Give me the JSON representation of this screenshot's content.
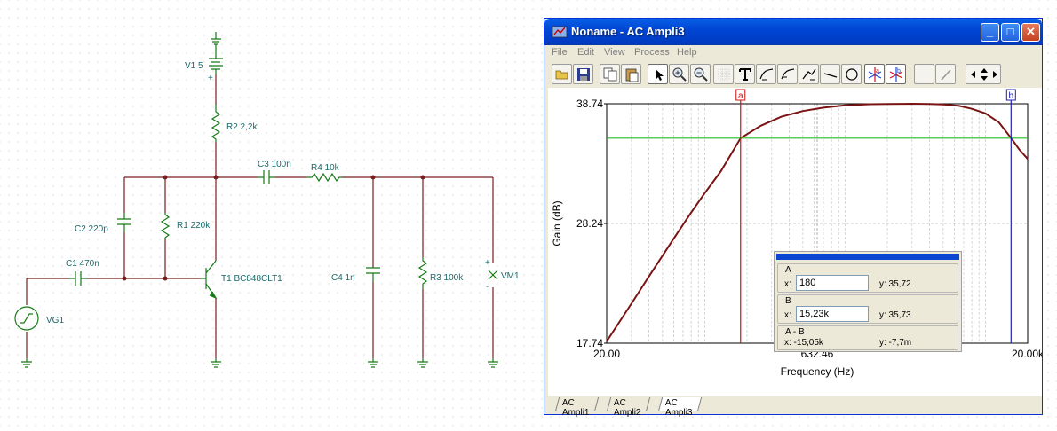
{
  "schematic": {
    "v1_label": "V1 5",
    "plus_sign": "+",
    "r2_label": "R2 2,2k",
    "c3_label": "C3 100n",
    "r4_label": "R4 10k",
    "c2_label": "C2 220p",
    "r1_label": "R1 220k",
    "c1_label": "C1 470n",
    "t1_label": "T1 BC848CLT1",
    "c4_label": "C4 1n",
    "r3_label": "R3 100k",
    "vm1_label": "VM1",
    "vm_plus": "+",
    "vm_minus": "-",
    "vg1_label": "VG1",
    "colors": {
      "wire": "#7a1f1f",
      "component": "#167a16",
      "label": "#1a6a6a"
    }
  },
  "window": {
    "title": "Noname - AC Ampli3",
    "menu": [
      "File",
      "Edit",
      "View",
      "Process",
      "Help"
    ],
    "minimize_glyph": "_",
    "maximize_glyph": "□",
    "close_glyph": "✕",
    "toolbar_icons": [
      "open-folder-icon",
      "save-icon",
      "copy-icon",
      "paste-icon",
      "pointer-icon",
      "zoom-in-icon",
      "zoom-100-icon",
      "grid-icon",
      "text-icon",
      "curve-tool-icon",
      "curve-tool-2-icon",
      "curve-tool-3-icon",
      "line-icon",
      "circle-icon",
      "cursor-a-icon",
      "cursor-b-icon",
      "blank-tool-icon",
      "pen-icon",
      "arrows-icon"
    ],
    "tabs": [
      "AC Ampli1",
      "AC Ampli2",
      "AC Ampli3"
    ],
    "active_tab": 2
  },
  "cursors": {
    "a_label": "a",
    "b_label": "b",
    "a_freq": 180,
    "b_freq": 15230,
    "level_db": 35.72
  },
  "cursor_panel": {
    "a": {
      "name": "A",
      "x_label": "x:",
      "x_value": "180",
      "y_text": "y: 35,72"
    },
    "b": {
      "name": "B",
      "x_label": "x:",
      "x_value": "15,23k",
      "y_text": "y: 35,73"
    },
    "ab": {
      "name": "A - B",
      "x_text": "x: -15,05k",
      "y_text": "y: -7,7m"
    }
  },
  "chart_data": {
    "type": "line",
    "xlabel": "Frequency (Hz)",
    "ylabel": "Gain (dB)",
    "x_scale": "log",
    "xlim": [
      20,
      20000
    ],
    "ylim": [
      17.74,
      38.74
    ],
    "x_ticks": [
      {
        "value": 20,
        "label": "20.00"
      },
      {
        "value": 632.46,
        "label": "632.46"
      },
      {
        "value": 20000,
        "label": "20.00k"
      }
    ],
    "y_ticks": [
      {
        "value": 38.74,
        "label": "38.74"
      },
      {
        "value": 28.24,
        "label": "28.24"
      },
      {
        "value": 17.74,
        "label": "17.74"
      }
    ],
    "grid": true,
    "series": [
      {
        "color": "#7a1414",
        "x": [
          20,
          30,
          40,
          60,
          80,
          100,
          130,
          180,
          250,
          350,
          500,
          700,
          1000,
          1500,
          2000,
          3000,
          4000,
          5000,
          6500,
          8000,
          10000,
          12500,
          15230,
          17500,
          20000
        ],
        "y": [
          17.9,
          21.2,
          23.6,
          26.9,
          29.2,
          30.9,
          32.8,
          35.72,
          36.8,
          37.6,
          38.1,
          38.4,
          38.6,
          38.7,
          38.72,
          38.74,
          38.72,
          38.68,
          38.55,
          38.3,
          37.9,
          37.1,
          35.73,
          34.7,
          33.9
        ]
      }
    ],
    "horizontal_marker": {
      "y": 35.72,
      "color": "#22bb22"
    },
    "cursor_lines": [
      {
        "name": "a",
        "x": 180,
        "color": "#d01010"
      },
      {
        "name": "b",
        "x": 15230,
        "color": "#2020b0"
      }
    ]
  }
}
